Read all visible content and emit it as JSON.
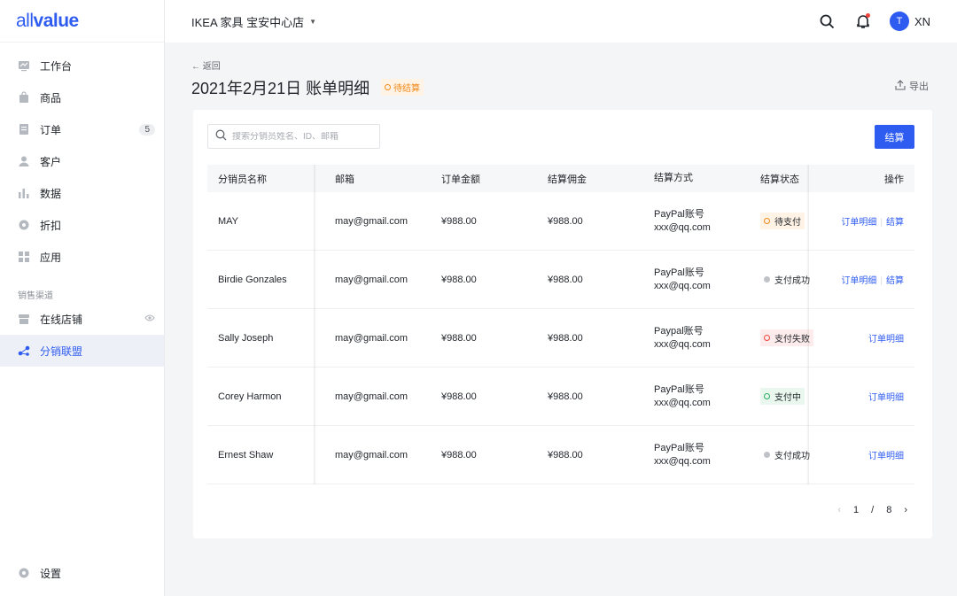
{
  "brand": {
    "logo_light": "all",
    "logo_bold": "value"
  },
  "sidebar": {
    "items": [
      {
        "label": "工作台",
        "icon": "dashboard-icon"
      },
      {
        "label": "商品",
        "icon": "bag-icon"
      },
      {
        "label": "订单",
        "icon": "order-icon",
        "badge": "5"
      },
      {
        "label": "客户",
        "icon": "user-icon"
      },
      {
        "label": "数据",
        "icon": "bar-chart-icon"
      },
      {
        "label": "折扣",
        "icon": "gear-discount-icon"
      },
      {
        "label": "应用",
        "icon": "apps-icon"
      }
    ],
    "section_label": "销售渠道",
    "channels": [
      {
        "label": "在线店铺",
        "icon": "store-icon"
      },
      {
        "label": "分销联盟",
        "icon": "affiliate-icon"
      }
    ],
    "settings_label": "设置"
  },
  "topbar": {
    "store_name": "IKEA 家具 宝安中心店",
    "avatar_letter": "T",
    "username": "XN"
  },
  "header": {
    "back_label": "返回",
    "title": "2021年2月21日 账单明细",
    "status": "待结算",
    "export_label": "导出"
  },
  "toolbar": {
    "search_placeholder": "搜索分销员姓名、ID、邮箱",
    "settle_label": "结算"
  },
  "table": {
    "columns": [
      "分销员名称",
      "邮箱",
      "订单金额",
      "结算佣金",
      "结算方式",
      "结算状态",
      "操作"
    ],
    "rows": [
      {
        "name": "MAY",
        "email": "may@gmail.com",
        "amount": "¥988.00",
        "commission": "¥988.00",
        "method": "PayPal账号",
        "account": "xxx@qq.com",
        "status": "待支付",
        "status_type": "orange",
        "action1": "订单明细",
        "action2": "结算"
      },
      {
        "name": "Birdie Gonzales",
        "email": "may@gmail.com",
        "amount": "¥988.00",
        "commission": "¥988.00",
        "method": "PayPal账号",
        "account": "xxx@qq.com",
        "status": "支付成功",
        "status_type": "gray",
        "action1": "订单明细",
        "action2": "结算"
      },
      {
        "name": "Sally Joseph",
        "email": "may@gmail.com",
        "amount": "¥988.00",
        "commission": "¥988.00",
        "method": "Paypal账号",
        "account": "xxx@qq.com",
        "status": "支付失败",
        "status_type": "red",
        "action1": "订单明细",
        "action2": ""
      },
      {
        "name": "Corey Harmon",
        "email": "may@gmail.com",
        "amount": "¥988.00",
        "commission": "¥988.00",
        "method": "PayPal账号",
        "account": "xxx@qq.com",
        "status": "支付中",
        "status_type": "green",
        "action1": "订单明细",
        "action2": ""
      },
      {
        "name": "Ernest Shaw",
        "email": "may@gmail.com",
        "amount": "¥988.00",
        "commission": "¥988.00",
        "method": "PayPal账号",
        "account": "xxx@qq.com",
        "status": "支付成功",
        "status_type": "gray",
        "action1": "订单明细",
        "action2": ""
      }
    ]
  },
  "pagination": {
    "current": "1",
    "divider": "/",
    "total": "8"
  },
  "colors": {
    "accent": "#2f5cf0",
    "warning": "#f0891b",
    "danger": "#f0443a",
    "success": "#27b060"
  }
}
